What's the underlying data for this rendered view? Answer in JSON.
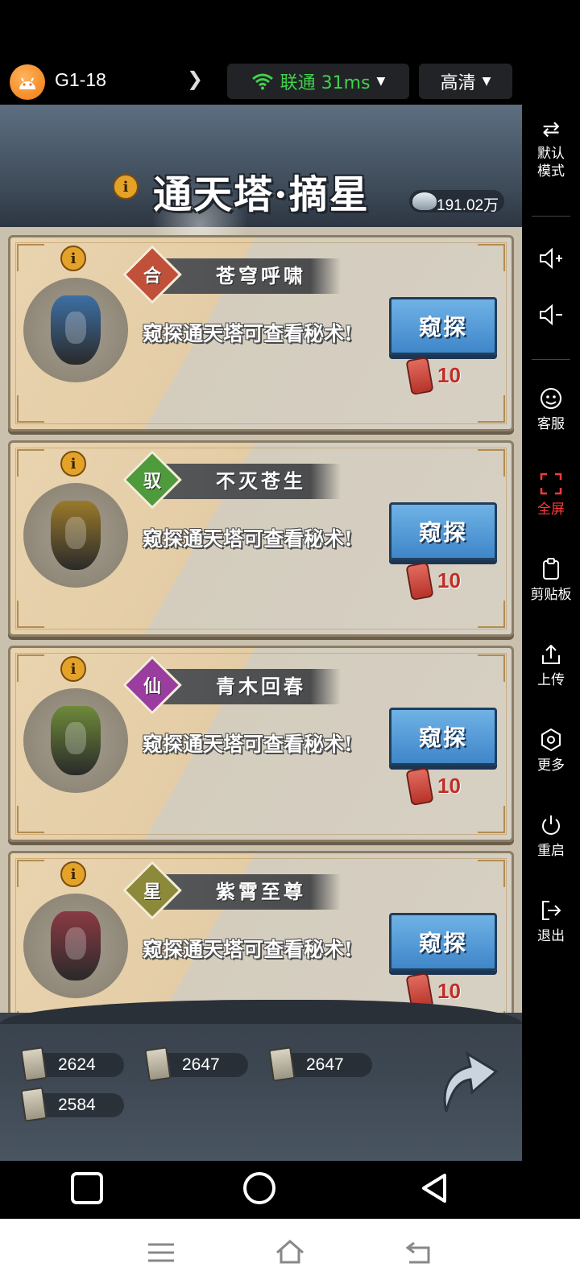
{
  "topbar": {
    "session_name": "G1-18",
    "network": "联通 31ms",
    "quality": "高清"
  },
  "game": {
    "title": "通天塔·摘星",
    "currency_value": "191.02万",
    "cards": [
      {
        "badge": "合",
        "badge_color": "#c0503a",
        "name": "苍穹呼啸",
        "desc": "窥探通天塔可查看秘术!",
        "button": "窥探",
        "cost": "10",
        "art_color": "#3d6fa3"
      },
      {
        "badge": "驭",
        "badge_color": "#4f9a3c",
        "name": "不灭苍生",
        "desc": "窥探通天塔可查看秘术!",
        "button": "窥探",
        "cost": "10",
        "art_color": "#9a7a2a"
      },
      {
        "badge": "仙",
        "badge_color": "#9a3d9e",
        "name": "青木回春",
        "desc": "窥探通天塔可查看秘术!",
        "button": "窥探",
        "cost": "10",
        "art_color": "#6e8a3a"
      },
      {
        "badge": "星",
        "badge_color": "#8c8a3a",
        "name": "紫霄至尊",
        "desc": "窥探通天塔可查看秘术!",
        "button": "窥探",
        "cost": "10",
        "art_color": "#8a3a44"
      }
    ],
    "resources": [
      "2624",
      "2647",
      "2647",
      "2584"
    ]
  },
  "sidebar": {
    "items": [
      {
        "icon": "⇄",
        "label": "默认\n模式"
      },
      {
        "icon": "🔈+",
        "label": ""
      },
      {
        "icon": "🔈-",
        "label": ""
      },
      {
        "icon": "☺",
        "label": "客服"
      },
      {
        "icon": "⛶",
        "label": "全屏"
      },
      {
        "icon": "📋",
        "label": "剪贴板"
      },
      {
        "icon": "⇪",
        "label": "上传"
      },
      {
        "icon": "◎",
        "label": "更多"
      },
      {
        "icon": "⏻",
        "label": "重启"
      },
      {
        "icon": "⇥",
        "label": "退出"
      }
    ]
  },
  "colors": {
    "network_green": "#3fd24c",
    "accent_red": "#ff3b3b",
    "button_blue": "#4a90d2"
  }
}
